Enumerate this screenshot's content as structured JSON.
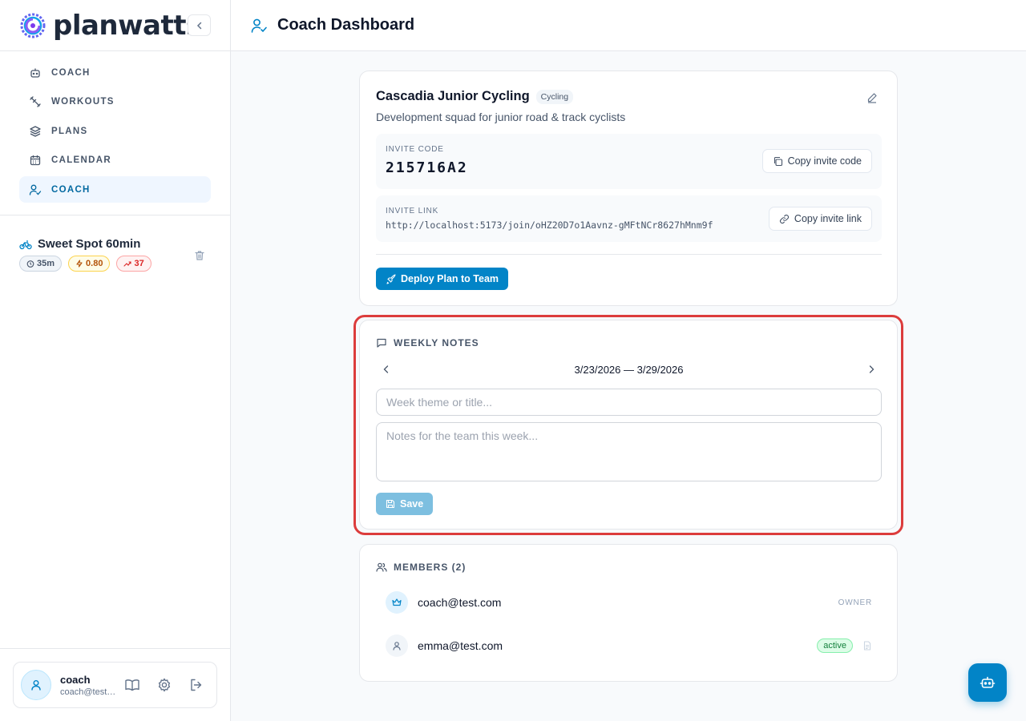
{
  "brand": {
    "name": "planwatts"
  },
  "header": {
    "title": "Coach Dashboard",
    "icon": "user-check-icon"
  },
  "sidebar": {
    "items": [
      {
        "label": "COACH",
        "icon": "bot-icon",
        "active": false
      },
      {
        "label": "WORKOUTS",
        "icon": "dumbbell-icon",
        "active": false
      },
      {
        "label": "PLANS",
        "icon": "layers-icon",
        "active": false
      },
      {
        "label": "CALENDAR",
        "icon": "calendar-icon",
        "active": false
      },
      {
        "label": "COACH",
        "icon": "user-check-icon",
        "active": true
      }
    ],
    "workout": {
      "title": "Sweet Spot 60min",
      "duration": "35m",
      "intensity": "0.80",
      "tss": "37"
    },
    "user": {
      "name": "coach",
      "email": "coach@test.com"
    }
  },
  "team": {
    "name": "Cascadia Junior Cycling",
    "tag": "Cycling",
    "description": "Development squad for junior road & track cyclists",
    "invite_code_label": "INVITE CODE",
    "invite_code": "215716A2",
    "copy_code_label": "Copy invite code",
    "invite_link_label": "INVITE LINK",
    "invite_link": "http://localhost:5173/join/oHZ20D7o1Aavnz-gMFtNCr8627hMnm9f",
    "copy_link_label": "Copy invite link",
    "deploy_label": "Deploy Plan to Team"
  },
  "notes": {
    "title": "WEEKLY NOTES",
    "week_range": "3/23/2026 — 3/29/2026",
    "theme_placeholder": "Week theme or title...",
    "notes_placeholder": "Notes for the team this week...",
    "save_label": "Save"
  },
  "members": {
    "title": "MEMBERS (2)",
    "list": [
      {
        "email": "coach@test.com",
        "role": "OWNER"
      },
      {
        "email": "emma@test.com",
        "status": "active"
      }
    ]
  },
  "colors": {
    "accent": "#0284c7",
    "highlight": "#dc3c3c",
    "active_green": "#15803d"
  }
}
